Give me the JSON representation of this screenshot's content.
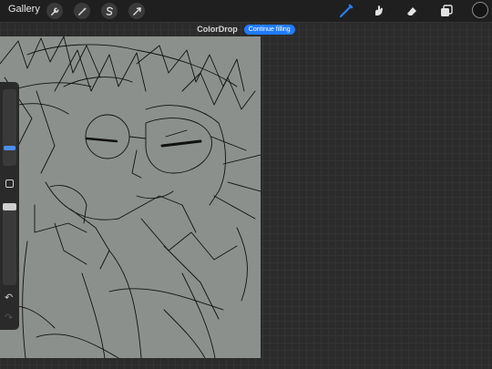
{
  "topbar": {
    "gallery_label": "Gallery",
    "left_tools": [
      "wrench-icon",
      "magic-wand-icon",
      "selection-icon",
      "transform-icon"
    ],
    "right_tools": [
      "brush-icon",
      "smudge-icon",
      "eraser-icon",
      "layers-icon"
    ],
    "active_tool": "brush-icon",
    "accent_color": "#2e7cf6",
    "current_color": "#151515"
  },
  "notice": {
    "title": "ColorDrop",
    "button_label": "Continue filling"
  },
  "canvas": {
    "background_color": "#8c908d",
    "stroke_color": "#111111"
  },
  "sidebar": {
    "icons": [
      "modify-square-icon",
      "undo-icon",
      "redo-icon"
    ]
  }
}
